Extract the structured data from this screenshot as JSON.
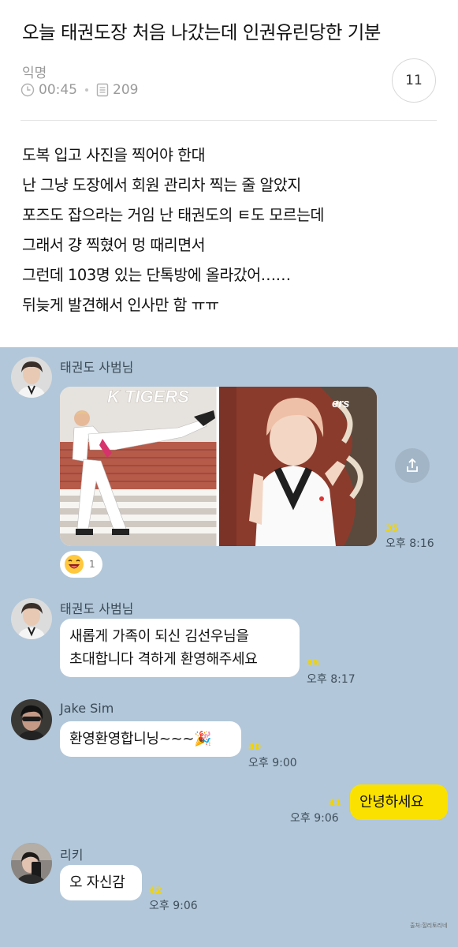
{
  "post": {
    "title": "오늘 태권도장 처음 나갔는데 인권유린당한 기분",
    "author": "익명",
    "time": "00:45",
    "views": "209",
    "comment_count": "11",
    "lines": [
      "도복 입고 사진을 찍어야 한대",
      "난 그냥 도장에서 회원 관리차 찍는 줄 알았지",
      "포즈도 잡으라는 거임 난 태권도의 ㅌ도 모르는데",
      "그래서 걍 찍혔어 멍 때리면서",
      "그런데 103명 있는 단톡방에 올라갔어……",
      "뒤늦게 발견해서 인사만 함 ㅠㅠ"
    ]
  },
  "chat": {
    "messages": [
      {
        "sender": "태권도 사범님",
        "unread": "35",
        "time": "오후 8:16",
        "photo_text": "K TIGERS",
        "reaction_count": "1"
      },
      {
        "sender": "태권도 사범님",
        "line1": "새롭게 가족이 되신 김선우님을",
        "line2": "초대합니다 격하게 환영해주세요",
        "unread": "35",
        "time": "오후 8:17"
      },
      {
        "sender": "Jake Sim",
        "text": "환영환영합니닝~~~",
        "emoji": "🎉",
        "unread": "40",
        "time": "오후 9:00"
      },
      {
        "text": "안녕하세요",
        "unread": "41",
        "time": "오후 9:06"
      },
      {
        "sender": "리키",
        "text": "오 자신감",
        "unread": "42",
        "time": "오후 9:06"
      }
    ]
  },
  "watermark": "출처:힐리토리네",
  "colors": {
    "chat_bg": "#b2c7d9",
    "my_bubble": "#fae100",
    "unread": "#f3d400"
  }
}
